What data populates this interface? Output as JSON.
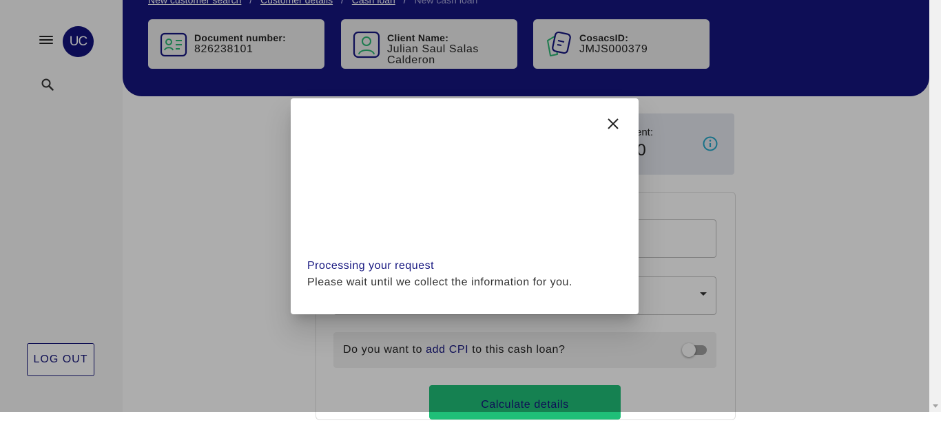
{
  "sidebar": {
    "avatar_initials": "UC",
    "menu_icon": "hamburger-menu-icon",
    "search_icon": "search-icon",
    "logout_label": "LOG OUT"
  },
  "header": {
    "breadcrumb": [
      "New customer search",
      "Customer details",
      "Cash loan",
      "New cash loan"
    ],
    "breadcrumb_sep": "/",
    "cards": [
      {
        "label": "Document number:",
        "value": "826238101",
        "icon": "id-card-icon"
      },
      {
        "label": "Client Name:",
        "value": "Julian Saul Salas Calderon",
        "icon": "person-icon"
      },
      {
        "label": "CosacsID:",
        "value": "JMJS000379",
        "icon": "cosacs-id-icon"
      }
    ]
  },
  "main": {
    "summary_label": "ent:",
    "summary_value": "00",
    "cpi_prefix": "Do you want to ",
    "cpi_emph": "add CPI",
    "cpi_suffix": " to this cash loan?",
    "cpi_enabled": false,
    "calculate_label": "Calculate details"
  },
  "dialog": {
    "title": "Processing your request",
    "message": "Please wait until we collect the information for you."
  },
  "colors": {
    "brand": "#15157f",
    "accent_green": "#1fbf78",
    "icon_green": "#2bb673",
    "info_teal": "#22a7c9"
  }
}
